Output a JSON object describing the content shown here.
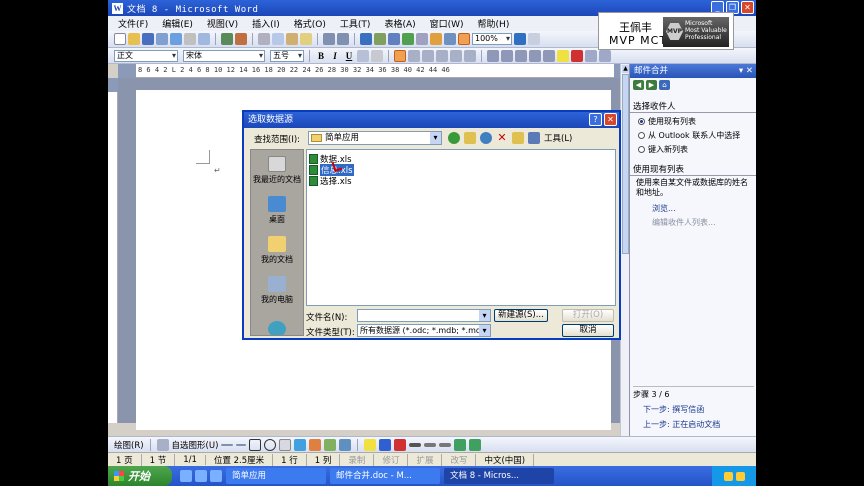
{
  "window": {
    "title": "文档 8 - Microsoft Word",
    "app_icon": "W"
  },
  "menu": [
    "文件(F)",
    "编辑(E)",
    "视图(V)",
    "插入(I)",
    "格式(O)",
    "工具(T)",
    "表格(A)",
    "窗口(W)",
    "帮助(H)"
  ],
  "toolbar": {
    "zoom": "100%"
  },
  "format_bar": {
    "style": "正文",
    "font": "宋体",
    "size": "五号",
    "bold": "B",
    "italic": "I",
    "underline": "U"
  },
  "ruler": {
    "numbers": "8  6  4  2  L  2  4  6  8  10  12  14  16  18  20  22  24  26  28  30  32  34  36  38  40  42  44  46"
  },
  "dialog": {
    "title": "选取数据源",
    "look_in_label": "查找范围(I):",
    "look_in_value": "简单应用",
    "tools_label": "工具(L)",
    "places": [
      "我最近的文档",
      "桌面",
      "我的文档",
      "我的电脑",
      ""
    ],
    "files": [
      {
        "name": "数据.xls",
        "selected": false
      },
      {
        "name": "信息.xls",
        "selected": true
      },
      {
        "name": "选择.xls",
        "selected": false
      }
    ],
    "filename_label": "文件名(N):",
    "filename_value": "",
    "filetype_label": "文件类型(T):",
    "filetype_value": "所有数据源 (*.odc; *.mdb; *.mde",
    "new_source_button": "新建源(S)...",
    "open_button": "打开(O)",
    "cancel_button": "取消"
  },
  "taskpane": {
    "title": "邮件合并",
    "section_recipients": "选择收件人",
    "options": [
      {
        "label": "使用现有列表",
        "checked": true
      },
      {
        "label": "从 Outlook 联系人中选择",
        "checked": false
      },
      {
        "label": "键入新列表",
        "checked": false
      }
    ],
    "section_existing": "使用现有列表",
    "description": "使用来自某文件或数据库的姓名和地址。",
    "browse_link": "浏览...",
    "edit_link": "编辑收件人列表...",
    "step": "步骤 3 / 6",
    "next_step": "下一步: 撰写信函",
    "prev_step": "上一步: 正在启动文档"
  },
  "drawbar": {
    "draw_label": "绘图(R)",
    "autoshapes_label": "自选图形(U)"
  },
  "status": [
    {
      "text": "1 页",
      "dim": false
    },
    {
      "text": "1 节",
      "dim": false
    },
    {
      "text": "1/1",
      "dim": false
    },
    {
      "text": "位置 2.5厘米",
      "dim": false
    },
    {
      "text": "1 行",
      "dim": false
    },
    {
      "text": "1 列",
      "dim": false
    },
    {
      "text": "录制",
      "dim": true
    },
    {
      "text": "修订",
      "dim": true
    },
    {
      "text": "扩展",
      "dim": true
    },
    {
      "text": "改写",
      "dim": true
    },
    {
      "text": "中文(中国)",
      "dim": false
    }
  ],
  "taskbar": {
    "start": "开始",
    "tasks": [
      {
        "label": "简单应用",
        "active": false
      },
      {
        "label": "邮件合并.doc - M...",
        "active": false
      },
      {
        "label": "文档 8 - Micros...",
        "active": true
      }
    ]
  },
  "logo": {
    "name": "王佩丰",
    "creds": "MVP  MCT",
    "hex": "MVP",
    "badge_line1": "Microsoft",
    "badge_line2": "Most Valuable",
    "badge_line3": "Professional"
  },
  "colors": {
    "titlebar": "#1b47b8",
    "taskbar": "#2454c8",
    "start": "#2d842d",
    "selection": "#316ac5"
  }
}
